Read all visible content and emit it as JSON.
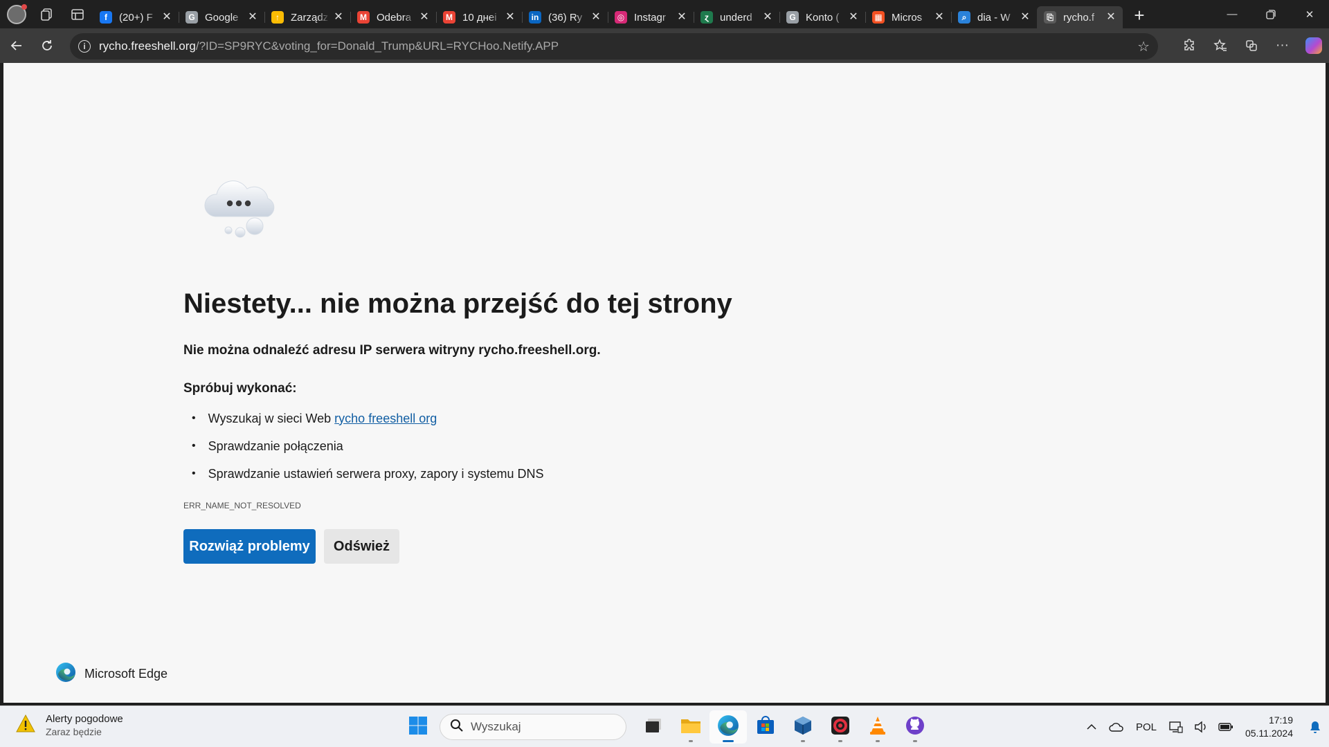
{
  "browser": {
    "tabs": [
      {
        "title": "(20+) F",
        "favicon": "facebook-icon",
        "color": "#1877f2",
        "glyph": "f",
        "active": false
      },
      {
        "title": "Google",
        "favicon": "google-icon",
        "color": "#9aa0a6",
        "glyph": "G",
        "active": false
      },
      {
        "title": "Zarządz",
        "favicon": "google-ads-icon",
        "color": "#fbbc04",
        "glyph": "↑",
        "active": false
      },
      {
        "title": "Odebra",
        "favicon": "gmail-icon",
        "color": "#ea4335",
        "glyph": "M",
        "active": false
      },
      {
        "title": "10 днеі",
        "favicon": "gmail-icon",
        "color": "#ea4335",
        "glyph": "M",
        "active": false
      },
      {
        "title": "(36) Ry",
        "favicon": "linkedin-icon",
        "color": "#0a66c2",
        "glyph": "in",
        "active": false
      },
      {
        "title": "Instagr",
        "favicon": "instagram-icon",
        "color": "#d62976",
        "glyph": "◎",
        "active": false
      },
      {
        "title": "underd",
        "favicon": "underdog-icon",
        "color": "#1f7a4d",
        "glyph": "ɀ",
        "active": false
      },
      {
        "title": "Konto (",
        "favicon": "google-icon",
        "color": "#9aa0a6",
        "glyph": "G",
        "active": false
      },
      {
        "title": "Micros",
        "favicon": "microsoft-icon",
        "color": "#f25022",
        "glyph": "▦",
        "active": false
      },
      {
        "title": "dia - W",
        "favicon": "search-icon",
        "color": "#2a82da",
        "glyph": "⌕",
        "active": false
      },
      {
        "title": "rycho.f",
        "favicon": "broken-page-icon",
        "color": "#5a5a5a",
        "glyph": "⎘",
        "active": true
      }
    ],
    "url_host": "rycho.freeshell.org",
    "url_rest": "/?ID=SP9RYC&voting_for=Donald_Trump&URL=RYCHoo.Netify.APP"
  },
  "error_page": {
    "title": "Niestety... nie można przejść do tej strony",
    "subtitle_prefix": "Nie można odnaleźć adresu IP serwera witryny ",
    "subtitle_host": "rycho.freeshell.org",
    "subtitle_suffix": ".",
    "try_heading": "Spróbuj wykonać:",
    "suggestions": {
      "search_prefix": "Wyszukaj w sieci Web",
      "search_link": "rycho freeshell org",
      "check_connection": "Sprawdzanie połączenia",
      "check_proxy": "Sprawdzanie ustawień serwera proxy, zapory i systemu DNS"
    },
    "error_code": "ERR_NAME_NOT_RESOLVED",
    "primary_button": "Rozwiąż problemy",
    "secondary_button": "Odśwież",
    "brand": "Microsoft Edge"
  },
  "taskbar": {
    "weather_title": "Alerty pogodowe",
    "weather_sub": "Zaraz będzie",
    "search_placeholder": "Wyszukaj",
    "apps": [
      "task-view-icon",
      "file-explorer-icon",
      "edge-icon",
      "microsoft-store-icon",
      "virtualbox-icon",
      "davinci-resolve-icon",
      "vlc-icon",
      "github-desktop-icon"
    ],
    "language": "POL",
    "time": "17:19",
    "date": "05.11.2024"
  }
}
